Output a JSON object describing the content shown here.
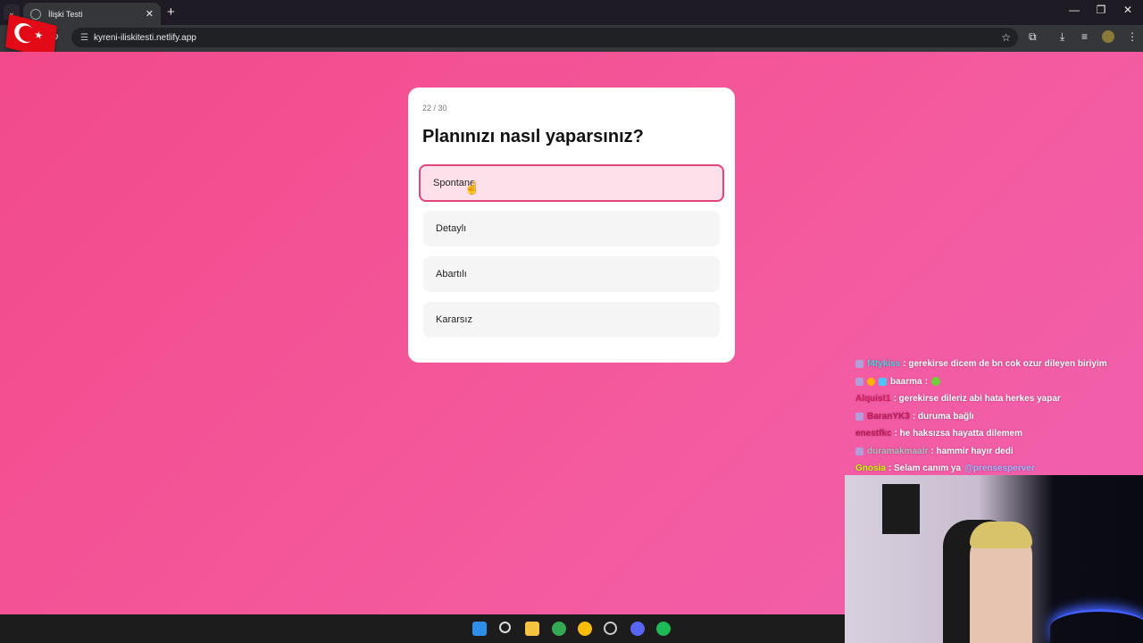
{
  "browser": {
    "tab_title": "İlişki Testi",
    "url": "kyreni-iliskitesti.netlify.app"
  },
  "quiz": {
    "progress": "22 / 30",
    "question": "Planınızı nasıl yaparsınız?",
    "options": [
      {
        "label": "Spontane",
        "selected": true
      },
      {
        "label": "Detaylı",
        "selected": false
      },
      {
        "label": "Abartılı",
        "selected": false
      },
      {
        "label": "Kararsız",
        "selected": false
      }
    ]
  },
  "chat": {
    "messages": [
      {
        "user": "f4tykiss",
        "text": ": gerekirse dicem de bn cok ozur dileyen biriyim",
        "user_color": "#4dd0e1"
      },
      {
        "user": "baarma",
        "text": ":",
        "user_color": "#ffffff"
      },
      {
        "user": "Alquist1",
        "text": ": gerekirse dileriz abi hata herkes yapar",
        "user_color": "#d81b60"
      },
      {
        "user": "BaranYK3",
        "text": ": duruma bağlı",
        "user_color": "#c2185b"
      },
      {
        "user": "enestfkc",
        "text": ": he haksızsa hayatta dilemem",
        "user_color": "#c2185b"
      },
      {
        "user": "duramakmaalr",
        "text": ": hammir hayır dedi",
        "user_color": "#b0bec5"
      },
      {
        "user": "Gnosia",
        "text": ": Selam canım ya",
        "mention": "@prensesperver",
        "user_color": "#c6ff00"
      }
    ]
  },
  "colors": {
    "page_bg": "#f24a8a",
    "accent": "#e0467a",
    "selected_bg": "#fde0ea"
  }
}
